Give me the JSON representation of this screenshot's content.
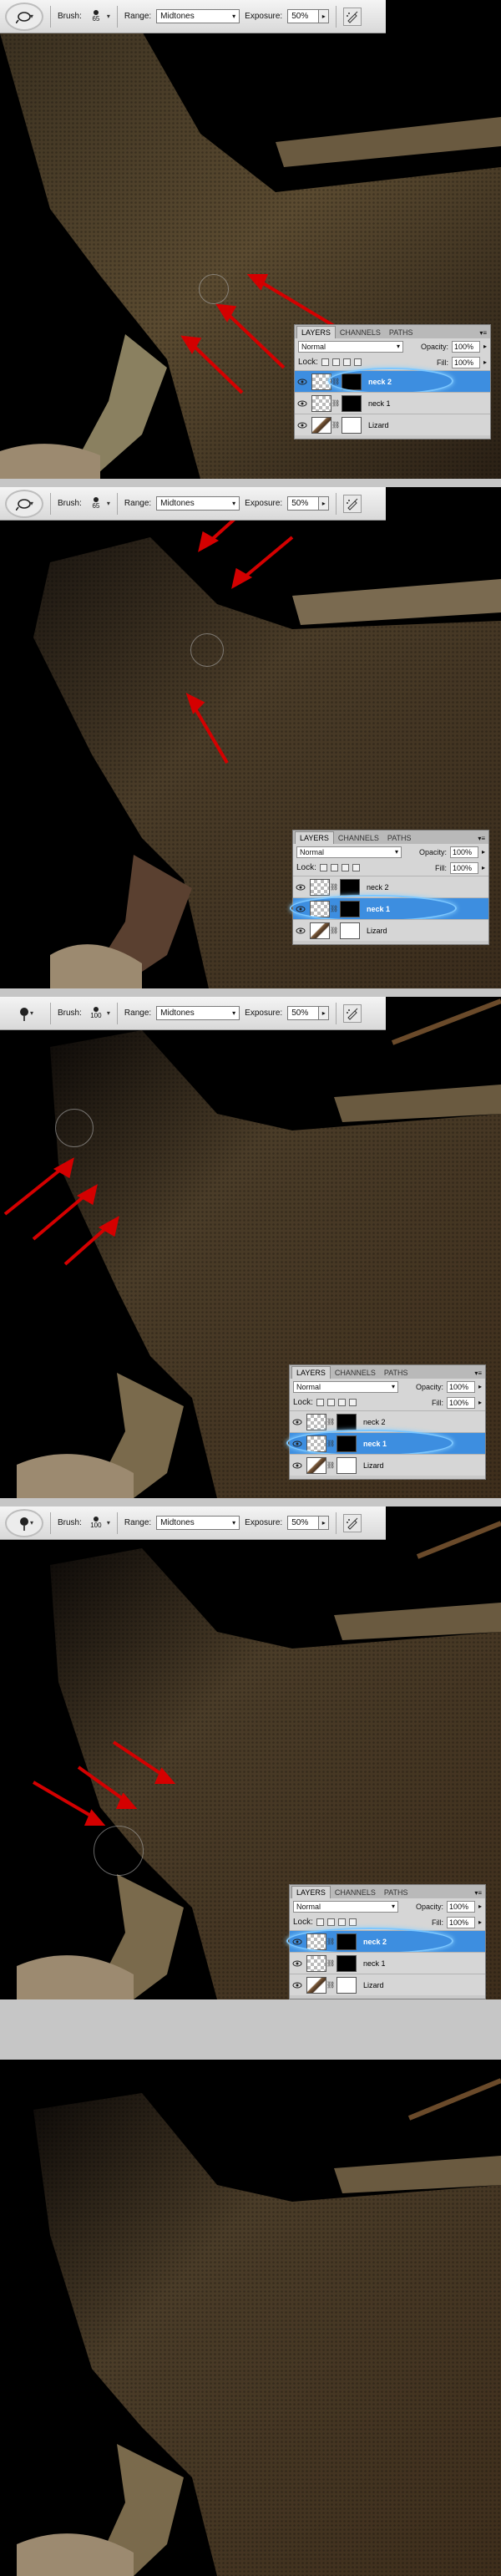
{
  "colors": {
    "background": "#000000",
    "arrow": "#d40000",
    "selected_layer": "#3d8ee0",
    "highlight_ring": "#7cc7ff",
    "divider": "#c6c6c6"
  },
  "tool": {
    "icon": "dodge-burn-tool-icon"
  },
  "toolbar": {
    "brush_label": "Brush:",
    "range_label": "Range:",
    "exposure_label": "Exposure:",
    "range_value": "Midtones",
    "exposure_value": "50%",
    "airbrush_icon": "airbrush-icon"
  },
  "layers_panel": {
    "tabs": [
      "LAYERS",
      "CHANNELS",
      "PATHS"
    ],
    "blend_mode": "Normal",
    "opacity_label": "Opacity:",
    "opacity_value": "100%",
    "lock_label": "Lock:",
    "fill_label": "Fill:",
    "fill_value": "100%",
    "layers": [
      "neck 2",
      "neck 1",
      "Lizard"
    ]
  },
  "steps": [
    {
      "brush_size": "65",
      "selected_layer": "neck 2",
      "tool_highlighted": true
    },
    {
      "brush_size": "65",
      "selected_layer": "neck 1",
      "tool_highlighted": true
    },
    {
      "brush_size": "100",
      "selected_layer": "neck 1",
      "tool_highlighted": false
    },
    {
      "brush_size": "100",
      "selected_layer": "neck 2",
      "tool_highlighted": true
    },
    {
      "brush_size": "",
      "selected_layer": "",
      "tool_highlighted": false
    }
  ]
}
